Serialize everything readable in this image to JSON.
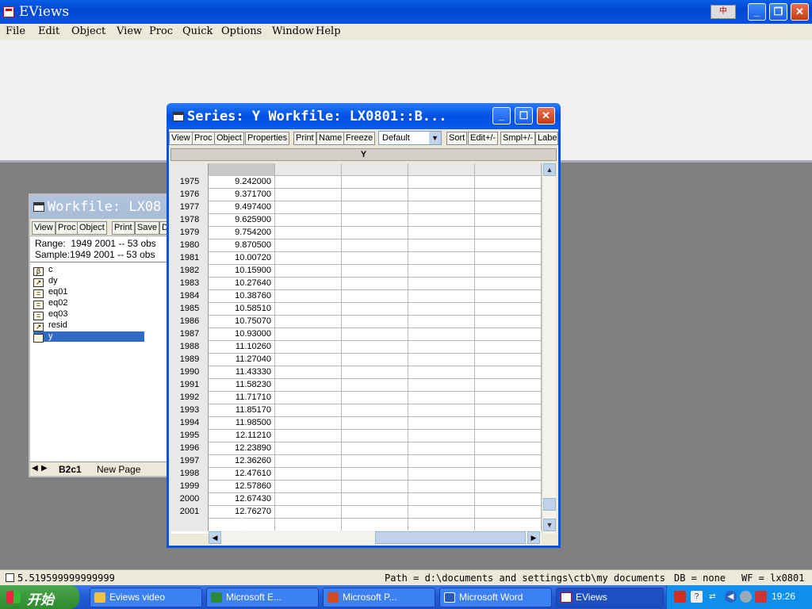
{
  "app": {
    "title": "EViews",
    "menu": [
      "File",
      "Edit",
      "Object",
      "View",
      "Proc",
      "Quick",
      "Options",
      "Window",
      "Help"
    ]
  },
  "workfile": {
    "title": "Workfile: LX08",
    "toolbar": [
      "View",
      "Proc",
      "Object",
      "Print",
      "Save",
      "D"
    ],
    "range_label": "Range:",
    "range_value": "1949 2001  --   53 obs",
    "sample_label": "Sample:",
    "sample_value": "1949 2001  --   53 obs",
    "objects": [
      {
        "name": "c",
        "icon": "beta-icon"
      },
      {
        "name": "dy",
        "icon": "series-icon"
      },
      {
        "name": "eq01",
        "icon": "equation-icon"
      },
      {
        "name": "eq02",
        "icon": "equation-icon"
      },
      {
        "name": "eq03",
        "icon": "equation-icon"
      },
      {
        "name": "resid",
        "icon": "series-icon"
      },
      {
        "name": "y",
        "icon": "series-icon",
        "selected": true
      }
    ],
    "tabs": [
      "B2c1",
      "New Page"
    ]
  },
  "series": {
    "title": "Series: Y    Workfile: LX0801::B...",
    "toolbar": [
      "View",
      "Proc",
      "Object",
      "Properties",
      "Print",
      "Name",
      "Freeze",
      "Sort",
      "Edit+/-",
      "Smpl+/-",
      "Labe"
    ],
    "dropdown_value": "Default",
    "column_header": "Y",
    "rows": [
      {
        "year": "1975",
        "value": "9.242000"
      },
      {
        "year": "1976",
        "value": "9.371700"
      },
      {
        "year": "1977",
        "value": "9.497400"
      },
      {
        "year": "1978",
        "value": "9.625900"
      },
      {
        "year": "1979",
        "value": "9.754200"
      },
      {
        "year": "1980",
        "value": "9.870500"
      },
      {
        "year": "1981",
        "value": "10.00720"
      },
      {
        "year": "1982",
        "value": "10.15900"
      },
      {
        "year": "1983",
        "value": "10.27640"
      },
      {
        "year": "1984",
        "value": "10.38760"
      },
      {
        "year": "1985",
        "value": "10.58510"
      },
      {
        "year": "1986",
        "value": "10.75070"
      },
      {
        "year": "1987",
        "value": "10.93000"
      },
      {
        "year": "1988",
        "value": "11.10260"
      },
      {
        "year": "1989",
        "value": "11.27040"
      },
      {
        "year": "1990",
        "value": "11.43330"
      },
      {
        "year": "1991",
        "value": "11.58230"
      },
      {
        "year": "1992",
        "value": "11.71710"
      },
      {
        "year": "1993",
        "value": "11.85170"
      },
      {
        "year": "1994",
        "value": "11.98500"
      },
      {
        "year": "1995",
        "value": "12.11210"
      },
      {
        "year": "1996",
        "value": "12.23890"
      },
      {
        "year": "1997",
        "value": "12.36260"
      },
      {
        "year": "1998",
        "value": "12.47610"
      },
      {
        "year": "1999",
        "value": "12.57860"
      },
      {
        "year": "2000",
        "value": "12.67430"
      },
      {
        "year": "2001",
        "value": "12.76270"
      }
    ]
  },
  "status": {
    "value": "5.519599999999999",
    "path": "Path = d:\\documents and settings\\ctb\\my documents",
    "db": "DB = none",
    "wf": "WF = lx0801"
  },
  "taskbar": {
    "start": "开始",
    "tasks": [
      "Eviews video",
      "Microsoft E...",
      "Microsoft P...",
      "Microsoft Word",
      "EViews"
    ],
    "clock": "19:26",
    "ime": "中"
  }
}
